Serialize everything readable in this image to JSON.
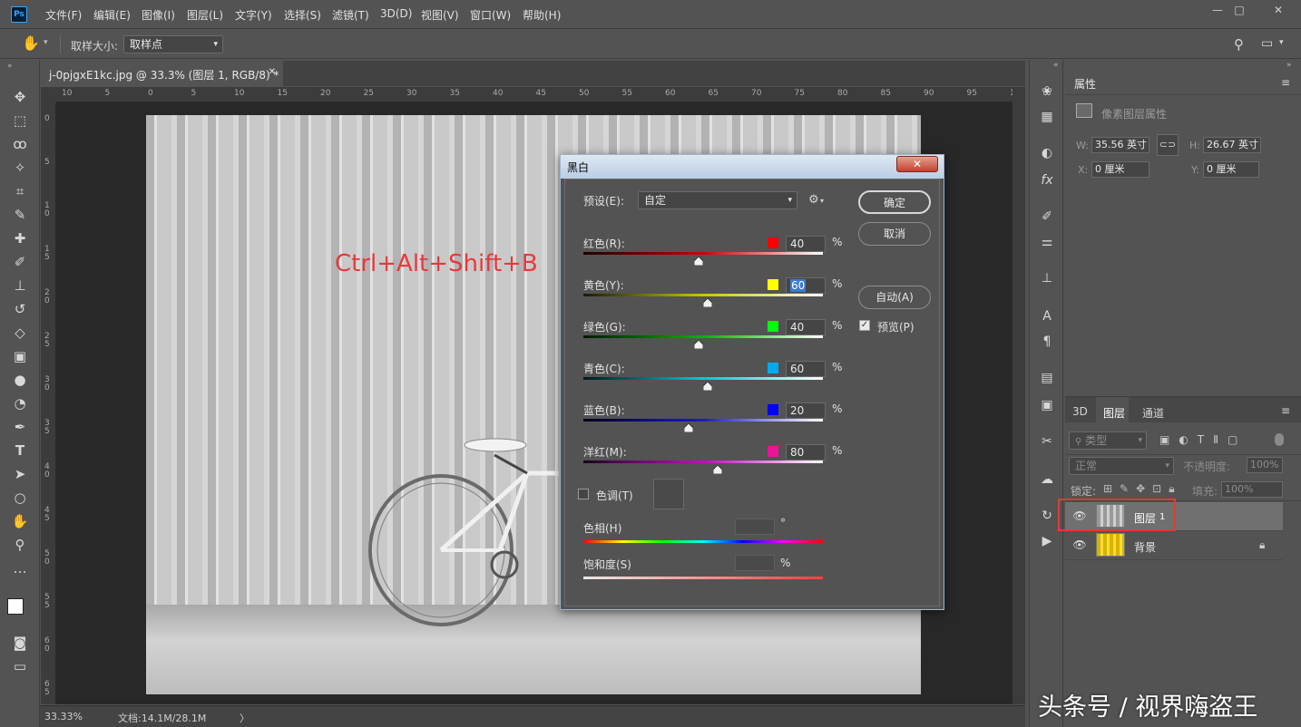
{
  "menubar": {
    "logo": "Ps",
    "items": [
      "文件(F)",
      "编辑(E)",
      "图像(I)",
      "图层(L)",
      "文字(Y)",
      "选择(S)",
      "滤镜(T)",
      "3D(D)",
      "视图(V)",
      "窗口(W)",
      "帮助(H)"
    ],
    "window_buttons": [
      "—",
      "□",
      "✕"
    ]
  },
  "optionsbar": {
    "sample_size_label": "取样大小:",
    "sample_size_value": "取样点"
  },
  "document": {
    "tab_title": "j-0pjgxE1kc.jpg @ 33.3% (图层 1, RGB/8) *",
    "tab_close": "✕"
  },
  "ruler": {
    "top_ticks": [
      "10",
      "5",
      "0",
      "5",
      "10",
      "15",
      "20",
      "25",
      "30",
      "35",
      "40",
      "45",
      "50",
      "55",
      "60",
      "65",
      "70",
      "75",
      "80",
      "85",
      "90",
      "95",
      "1"
    ],
    "left_ticks": [
      "0",
      "5",
      "1 0",
      "1 5",
      "2 0",
      "2 5",
      "3 0",
      "3 5",
      "4 0",
      "4 5",
      "5 0",
      "5 5",
      "6 0",
      "6 5"
    ]
  },
  "annotation": {
    "shortcut": "Ctrl+Alt+Shift+B"
  },
  "status": {
    "zoom": "33.33%",
    "doc_size": "文档:14.1M/28.1M",
    "arrow": "〉"
  },
  "dialog": {
    "title": "黑白",
    "close": "✕",
    "preset_label": "预设(E):",
    "preset_value": "自定",
    "ok_label": "确定",
    "cancel_label": "取消",
    "auto_label": "自动(A)",
    "preview_label": "预览(P)",
    "preview_checked": true,
    "channels": [
      {
        "label": "红色(R):",
        "value": "40",
        "color": "#ff0000",
        "grad": "linear-gradient(90deg,#1a0000,#cc0000,#ffffff)",
        "pos": 0.48
      },
      {
        "label": "黄色(Y):",
        "value": "60",
        "color": "#ffff00",
        "grad": "linear-gradient(90deg,#1a1a00,#c8c800,#ffffff)",
        "pos": 0.52
      },
      {
        "label": "绿色(G):",
        "value": "40",
        "color": "#00ff00",
        "grad": "linear-gradient(90deg,#001a00,#00b400,#ffffff)",
        "pos": 0.48
      },
      {
        "label": "青色(C):",
        "value": "60",
        "color": "#00aaee",
        "grad": "linear-gradient(90deg,#001a1a,#00c8c8,#ffffff)",
        "pos": 0.52
      },
      {
        "label": "蓝色(B):",
        "value": "20",
        "color": "#0000ff",
        "grad": "linear-gradient(90deg,#00001a,#1a1acc,#ffffff)",
        "pos": 0.44
      },
      {
        "label": "洋红(M):",
        "value": "80",
        "color": "#ee1199",
        "grad": "linear-gradient(90deg,#1a001a,#c800c8,#ffffff)",
        "pos": 0.56
      }
    ],
    "tint_label": "色调(T)",
    "hue_label": "色相(H)",
    "hue_unit": "°",
    "saturation_label": "饱和度(S)",
    "saturation_unit": "%",
    "percent": "%"
  },
  "properties_panel": {
    "tab": "属性",
    "subtitle": "像素图层属性",
    "w_label": "W:",
    "w_value": "35.56 英寸",
    "h_label": "H:",
    "h_value": "26.67 英寸",
    "x_label": "X:",
    "x_value": "0 厘米",
    "y_label": "Y:",
    "y_value": "0 厘米"
  },
  "layers_panel": {
    "tabs": [
      "3D",
      "图层",
      "通道"
    ],
    "filter_label": "类型",
    "blend_mode": "正常",
    "opacity_label": "不透明度:",
    "opacity_value": "100%",
    "lock_label": "锁定:",
    "fill_label": "填充:",
    "fill_value": "100%",
    "layers": [
      {
        "name": "图层",
        "suffix": "1",
        "selected": true
      },
      {
        "name": "背景",
        "suffix": "",
        "selected": false,
        "locked": true
      }
    ]
  },
  "watermark": "头条号 / 视界嗨盗王",
  "colors": {
    "ui_bg": "#535353",
    "annotation_red": "#e8383a",
    "highlight_box": "#e53935"
  }
}
